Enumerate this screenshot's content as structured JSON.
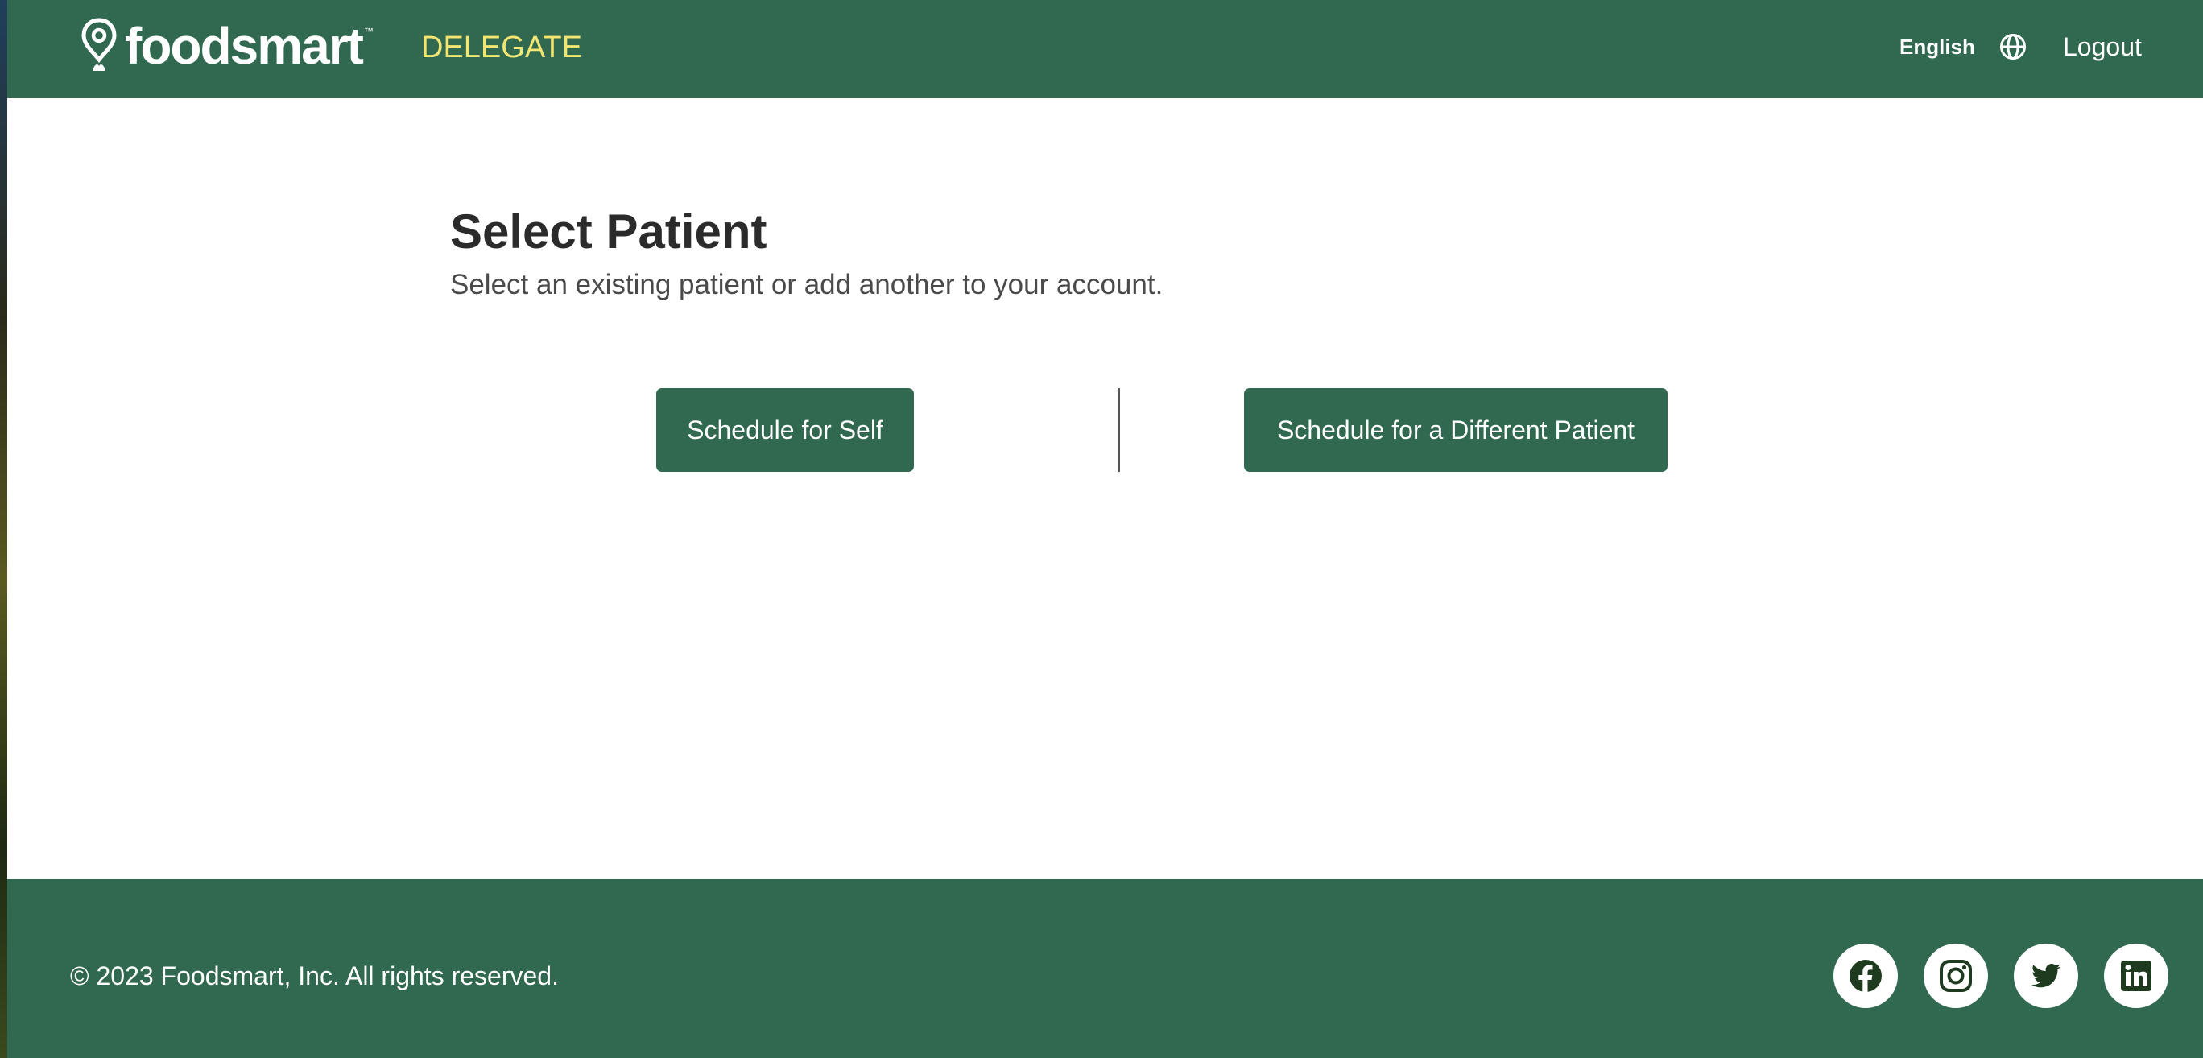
{
  "header": {
    "logo_text": "foodsmart",
    "logo_tm": "™",
    "section_label": "DELEGATE",
    "language_label": "English",
    "logout_label": "Logout"
  },
  "main": {
    "title": "Select Patient",
    "subtitle": "Select an existing patient or add another to your account.",
    "buttons": {
      "self_label": "Schedule for Self",
      "other_label": "Schedule for a Different Patient"
    }
  },
  "footer": {
    "copyright": "© 2023 Foodsmart, Inc. All rights reserved.",
    "social_icons": [
      "facebook-icon",
      "instagram-icon",
      "twitter-icon",
      "linkedin-icon"
    ]
  },
  "colors": {
    "brand_green": "#30694f",
    "accent_yellow": "#f2e571",
    "title_text": "#2b2b2b",
    "subtitle_text": "#4a4a4a",
    "footer_icon": "#1e3a1f"
  }
}
